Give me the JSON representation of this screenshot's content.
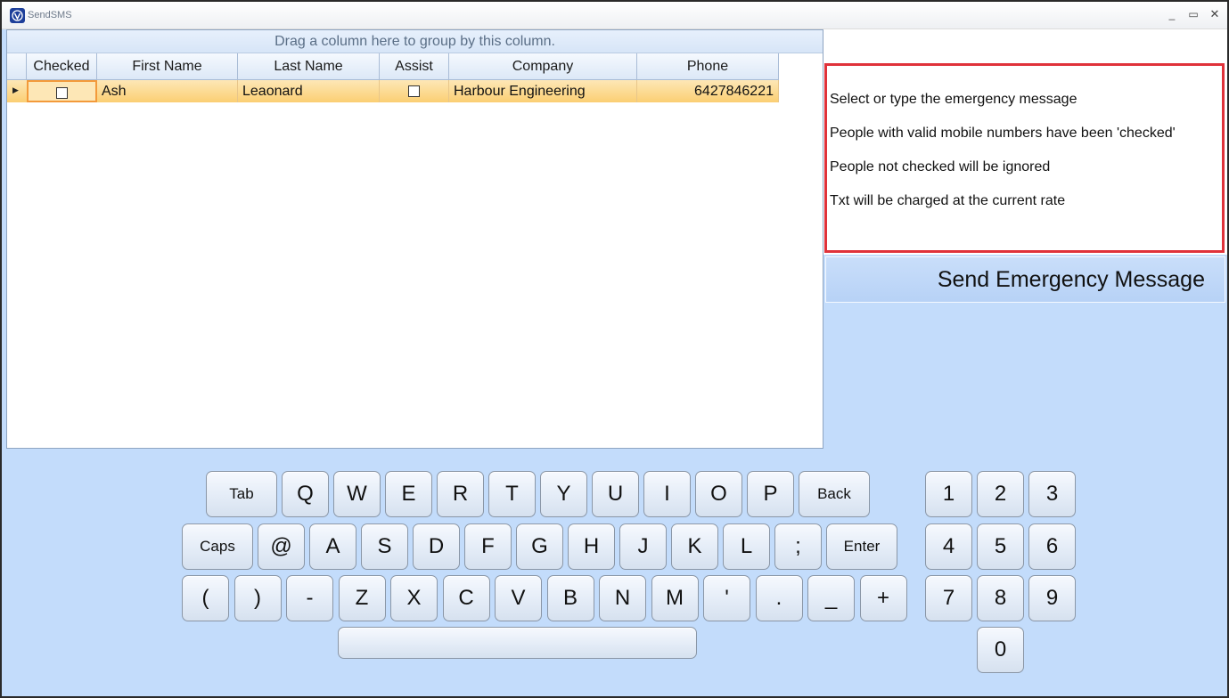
{
  "window": {
    "title": "SendSMS",
    "min": "_",
    "max": "▭",
    "close": "✕"
  },
  "grid": {
    "group_hint": "Drag a column here to group by this column.",
    "columns": [
      "Checked",
      "First Name",
      "Last Name",
      "Assist",
      "Company",
      "Phone"
    ],
    "rows": [
      {
        "checked": false,
        "first_name": "Ash",
        "last_name": "Leaonard",
        "assist": false,
        "company": "Harbour Engineering",
        "phone": "6427846221"
      }
    ]
  },
  "info": {
    "lines": [
      "Select or type the emergency message",
      "People with valid mobile numbers have been 'checked'",
      "People not checked will be ignored",
      "Txt will be charged at the current rate"
    ]
  },
  "send_button": "Send Emergency Message",
  "keyboard": {
    "row1": [
      "Tab",
      "Q",
      "W",
      "E",
      "R",
      "T",
      "Y",
      "U",
      "I",
      "O",
      "P",
      "Back"
    ],
    "row2": [
      "Caps",
      "@",
      "A",
      "S",
      "D",
      "F",
      "G",
      "H",
      "J",
      "K",
      "L",
      ";",
      "Enter"
    ],
    "row3": [
      "(",
      ")",
      "-",
      "Z",
      "X",
      "C",
      "V",
      "B",
      "N",
      "M",
      "'",
      ".",
      "_",
      "+"
    ],
    "space": ""
  },
  "numpad": [
    "1",
    "2",
    "3",
    "4",
    "5",
    "6",
    "7",
    "8",
    "9",
    "0"
  ]
}
